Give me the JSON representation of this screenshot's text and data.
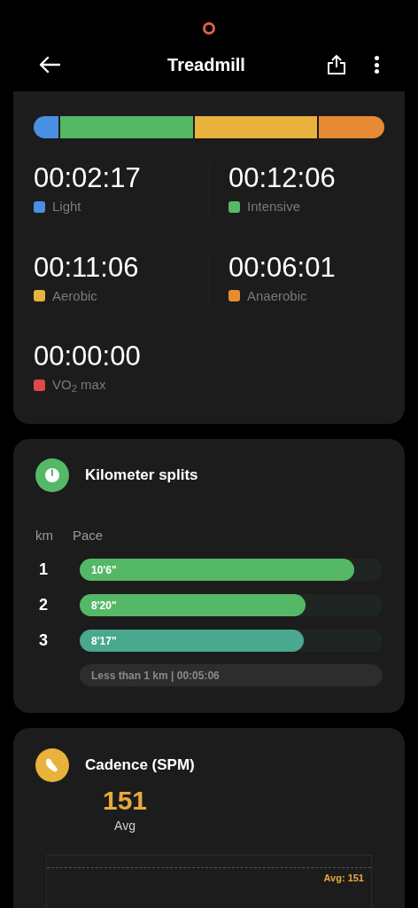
{
  "header": {
    "title": "Treadmill"
  },
  "zones": {
    "segments": [
      {
        "color": "#4a90e2"
      },
      {
        "color": "#55b866"
      },
      {
        "color": "#e8b23c"
      },
      {
        "color": "#e88a34"
      }
    ],
    "items": [
      {
        "time": "00:02:17",
        "label": "Light",
        "color": "#4a90e2"
      },
      {
        "time": "00:12:06",
        "label": "Intensive",
        "color": "#55b866"
      },
      {
        "time": "00:11:06",
        "label": "Aerobic",
        "color": "#e8b23c"
      },
      {
        "time": "00:06:01",
        "label": "Anaerobic",
        "color": "#e88a34"
      },
      {
        "time": "00:00:00",
        "label": "VO$_{2}$ max",
        "color": "#e04848"
      }
    ]
  },
  "splits": {
    "title": "Kilometer splits",
    "columns": [
      "km",
      "Pace"
    ],
    "rows": [
      {
        "km": "1",
        "pace": "10'6\"",
        "level": 0.905,
        "color": "#55b866"
      },
      {
        "km": "2",
        "pace": "8'20\"",
        "level": 0.745,
        "color": "#55b866"
      },
      {
        "km": "3",
        "pace": "8'17\"",
        "level": 0.74,
        "color": "#4aa88e"
      }
    ],
    "footer": "Less than 1 km | 00:05:06"
  },
  "cadence": {
    "title": "Cadence (SPM)",
    "value": "151",
    "value_label": "Avg",
    "avg_line_label": "Avg: 151"
  }
}
